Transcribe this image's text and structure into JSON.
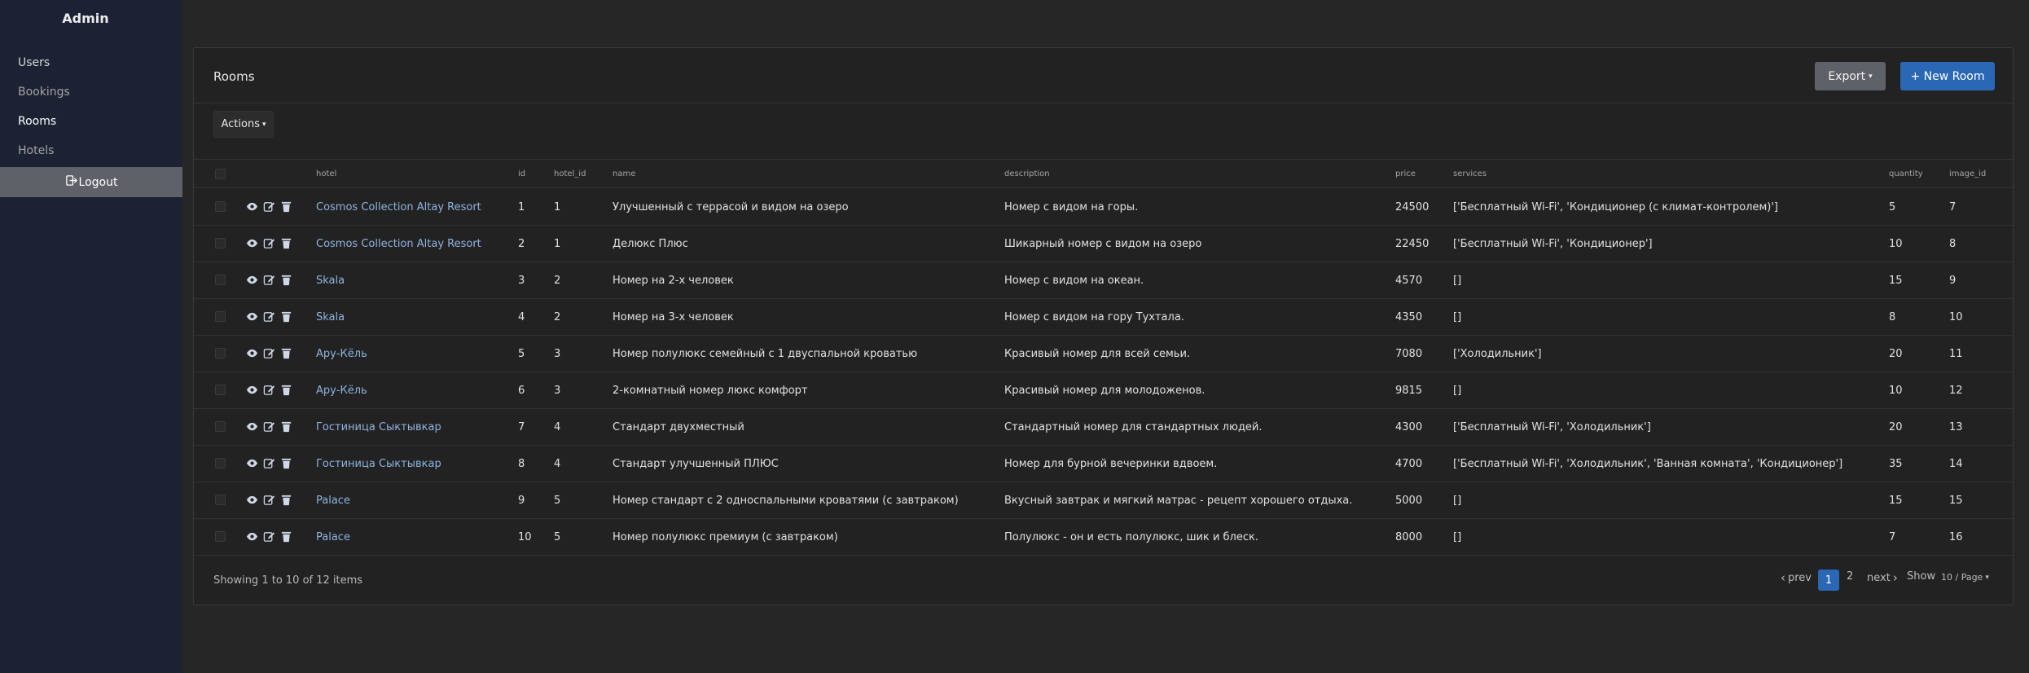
{
  "sidebar": {
    "brand": "Admin",
    "items": [
      {
        "label": "Users"
      },
      {
        "label": "Bookings"
      },
      {
        "label": "Rooms"
      },
      {
        "label": "Hotels"
      }
    ],
    "logout_label": "Logout"
  },
  "page": {
    "title": "Rooms",
    "export_label": "Export",
    "new_label": "+ New Room",
    "actions_label": "Actions"
  },
  "table": {
    "columns": [
      "hotel",
      "id",
      "hotel_id",
      "name",
      "description",
      "price",
      "services",
      "quantity",
      "image_id"
    ],
    "rows": [
      {
        "hotel": "Cosmos Collection Altay Resort",
        "id": "1",
        "hotel_id": "1",
        "name": "Улучшенный с террасой и видом на озеро",
        "description": "Номер с видом на горы.",
        "price": "24500",
        "services": "['Бесплатный Wi-Fi', 'Кондиционер (с климат-контролем)']",
        "quantity": "5",
        "image_id": "7"
      },
      {
        "hotel": "Cosmos Collection Altay Resort",
        "id": "2",
        "hotel_id": "1",
        "name": "Делюкс Плюс",
        "description": "Шикарный номер с видом на озеро",
        "price": "22450",
        "services": "['Бесплатный Wi-Fi', 'Кондиционер']",
        "quantity": "10",
        "image_id": "8"
      },
      {
        "hotel": "Skala",
        "id": "3",
        "hotel_id": "2",
        "name": "Номер на 2-х человек",
        "description": "Номер с видом на океан.",
        "price": "4570",
        "services": "[]",
        "quantity": "15",
        "image_id": "9"
      },
      {
        "hotel": "Skala",
        "id": "4",
        "hotel_id": "2",
        "name": "Номер на 3-х человек",
        "description": "Номер с видом на гору Тухтала.",
        "price": "4350",
        "services": "[]",
        "quantity": "8",
        "image_id": "10"
      },
      {
        "hotel": "Ару-Кёль",
        "id": "5",
        "hotel_id": "3",
        "name": "Номер полулюкс семейный с 1 двуспальной кроватью",
        "description": "Красивый номер для всей семьи.",
        "price": "7080",
        "services": "['Холодильник']",
        "quantity": "20",
        "image_id": "11"
      },
      {
        "hotel": "Ару-Кёль",
        "id": "6",
        "hotel_id": "3",
        "name": "2-комнатный номер люкс комфорт",
        "description": "Красивый номер для молодоженов.",
        "price": "9815",
        "services": "[]",
        "quantity": "10",
        "image_id": "12"
      },
      {
        "hotel": "Гостиница Сыктывкар",
        "id": "7",
        "hotel_id": "4",
        "name": "Стандарт двухместный",
        "description": "Стандартный номер для стандартных людей.",
        "price": "4300",
        "services": "['Бесплатный Wi-Fi', 'Холодильник']",
        "quantity": "20",
        "image_id": "13"
      },
      {
        "hotel": "Гостиница Сыктывкар",
        "id": "8",
        "hotel_id": "4",
        "name": "Стандарт улучшенный ПЛЮС",
        "description": "Номер для бурной вечеринки вдвоем.",
        "price": "4700",
        "services": "['Бесплатный Wi-Fi', 'Холодильник', 'Ванная комната', 'Кондиционер']",
        "quantity": "35",
        "image_id": "14"
      },
      {
        "hotel": "Palace",
        "id": "9",
        "hotel_id": "5",
        "name": "Номер стандарт с 2 односпальными кроватями (с завтраком)",
        "description": "Вкусный завтрак и мягкий матрас - рецепт хорошего отдыха.",
        "price": "5000",
        "services": "[]",
        "quantity": "15",
        "image_id": "15"
      },
      {
        "hotel": "Palace",
        "id": "10",
        "hotel_id": "5",
        "name": "Номер полулюкс премиум (с завтраком)",
        "description": "Полулюкс - он и есть полулюкс, шик и блеск.",
        "price": "8000",
        "services": "[]",
        "quantity": "7",
        "image_id": "16"
      }
    ]
  },
  "footer": {
    "showing": "Showing 1 to 10 of 12 items",
    "prev": "prev",
    "pages": [
      "1",
      "2"
    ],
    "next": "next",
    "show_label": "Show",
    "page_size": "10 / Page"
  },
  "colors": {
    "accent": "#2a67b5",
    "sidebar_bg": "#1c2233",
    "link": "#8fb4e0"
  }
}
